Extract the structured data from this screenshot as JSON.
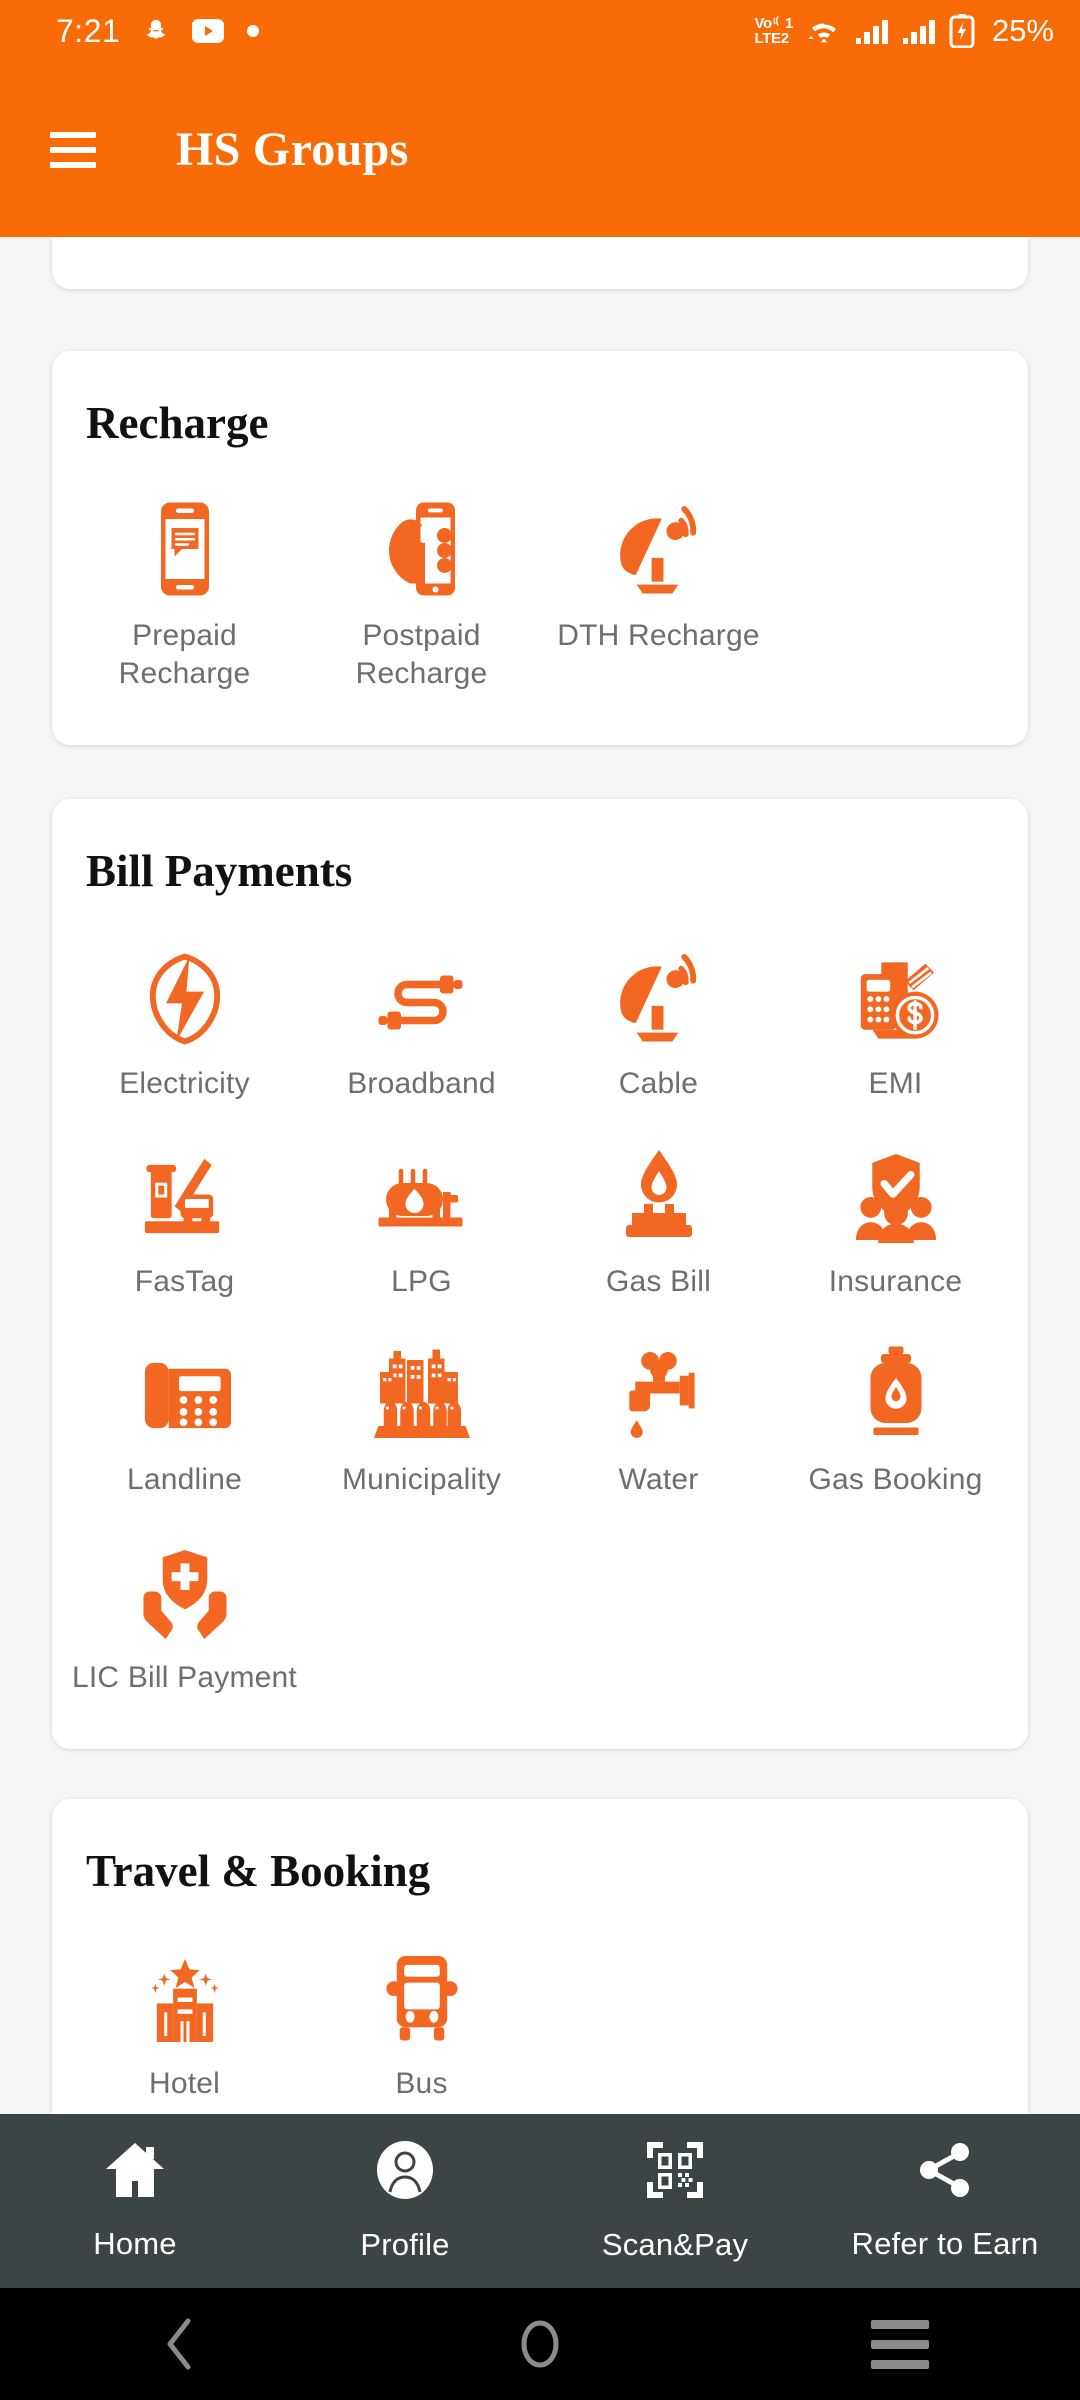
{
  "statusbar": {
    "time": "7:21",
    "battery_percent": "25%",
    "volte_line1": "Vo",
    "volte_sim1": "1",
    "volte_line2": "LTE",
    "volte_sim2": "2",
    "icons": [
      "snapchat-icon",
      "youtube-icon",
      "dot-icon",
      "volte-icon",
      "wifi-icon",
      "signal-icon",
      "signal-icon",
      "battery-charging-icon"
    ]
  },
  "appbar": {
    "title": "HS Groups",
    "menu_icon": "hamburger-icon",
    "background_color": "#F96B07"
  },
  "theme": {
    "accent": "#F96B07",
    "icon_orange": "#F26722",
    "page_background": "#F4F6F6",
    "card_background": "#FFFFFF",
    "label_color": "#6E6E6E",
    "bottomnav_background": "#3C4446"
  },
  "sections": [
    {
      "title": "Recharge",
      "items": [
        {
          "label": "Prepaid Recharge",
          "icon": "mobile-message-icon"
        },
        {
          "label": "Postpaid Recharge",
          "icon": "hand-phone-icon"
        },
        {
          "label": "DTH Recharge",
          "icon": "satellite-dish-icon"
        }
      ]
    },
    {
      "title": "Bill Payments",
      "items": [
        {
          "label": "Electricity",
          "icon": "lightning-bolt-icon"
        },
        {
          "label": "Broadband",
          "icon": "cable-plug-icon"
        },
        {
          "label": "Cable",
          "icon": "satellite-dish-icon"
        },
        {
          "label": "EMI",
          "icon": "calculator-money-icon"
        },
        {
          "label": "FasTag",
          "icon": "toll-barrier-icon"
        },
        {
          "label": "LPG",
          "icon": "lpg-tanker-icon"
        },
        {
          "label": "Gas Bill",
          "icon": "gas-stove-flame-icon"
        },
        {
          "label": "Insurance",
          "icon": "family-shield-icon"
        },
        {
          "label": "Landline",
          "icon": "landline-phone-icon"
        },
        {
          "label": "Municipality",
          "icon": "city-buildings-icon"
        },
        {
          "label": "Water",
          "icon": "water-tap-icon"
        },
        {
          "label": "Gas Booking",
          "icon": "gas-cylinder-icon"
        },
        {
          "label": "LIC Bill Payment",
          "icon": "hands-shield-plus-icon"
        }
      ]
    },
    {
      "title": "Travel & Booking",
      "items": [
        {
          "label": "Hotel",
          "icon": "hotel-star-icon"
        },
        {
          "label": "Bus",
          "icon": "bus-icon"
        }
      ]
    }
  ],
  "bottomnav": {
    "items": [
      {
        "label": "Home",
        "icon": "home-icon"
      },
      {
        "label": "Profile",
        "icon": "person-circle-icon"
      },
      {
        "label": "Scan&Pay",
        "icon": "qr-code-icon"
      },
      {
        "label": "Refer to Earn",
        "icon": "share-icon"
      }
    ]
  },
  "sysnav": {
    "back": "back-chevron-icon",
    "home": "home-circle-icon",
    "recents": "recents-menu-icon"
  }
}
